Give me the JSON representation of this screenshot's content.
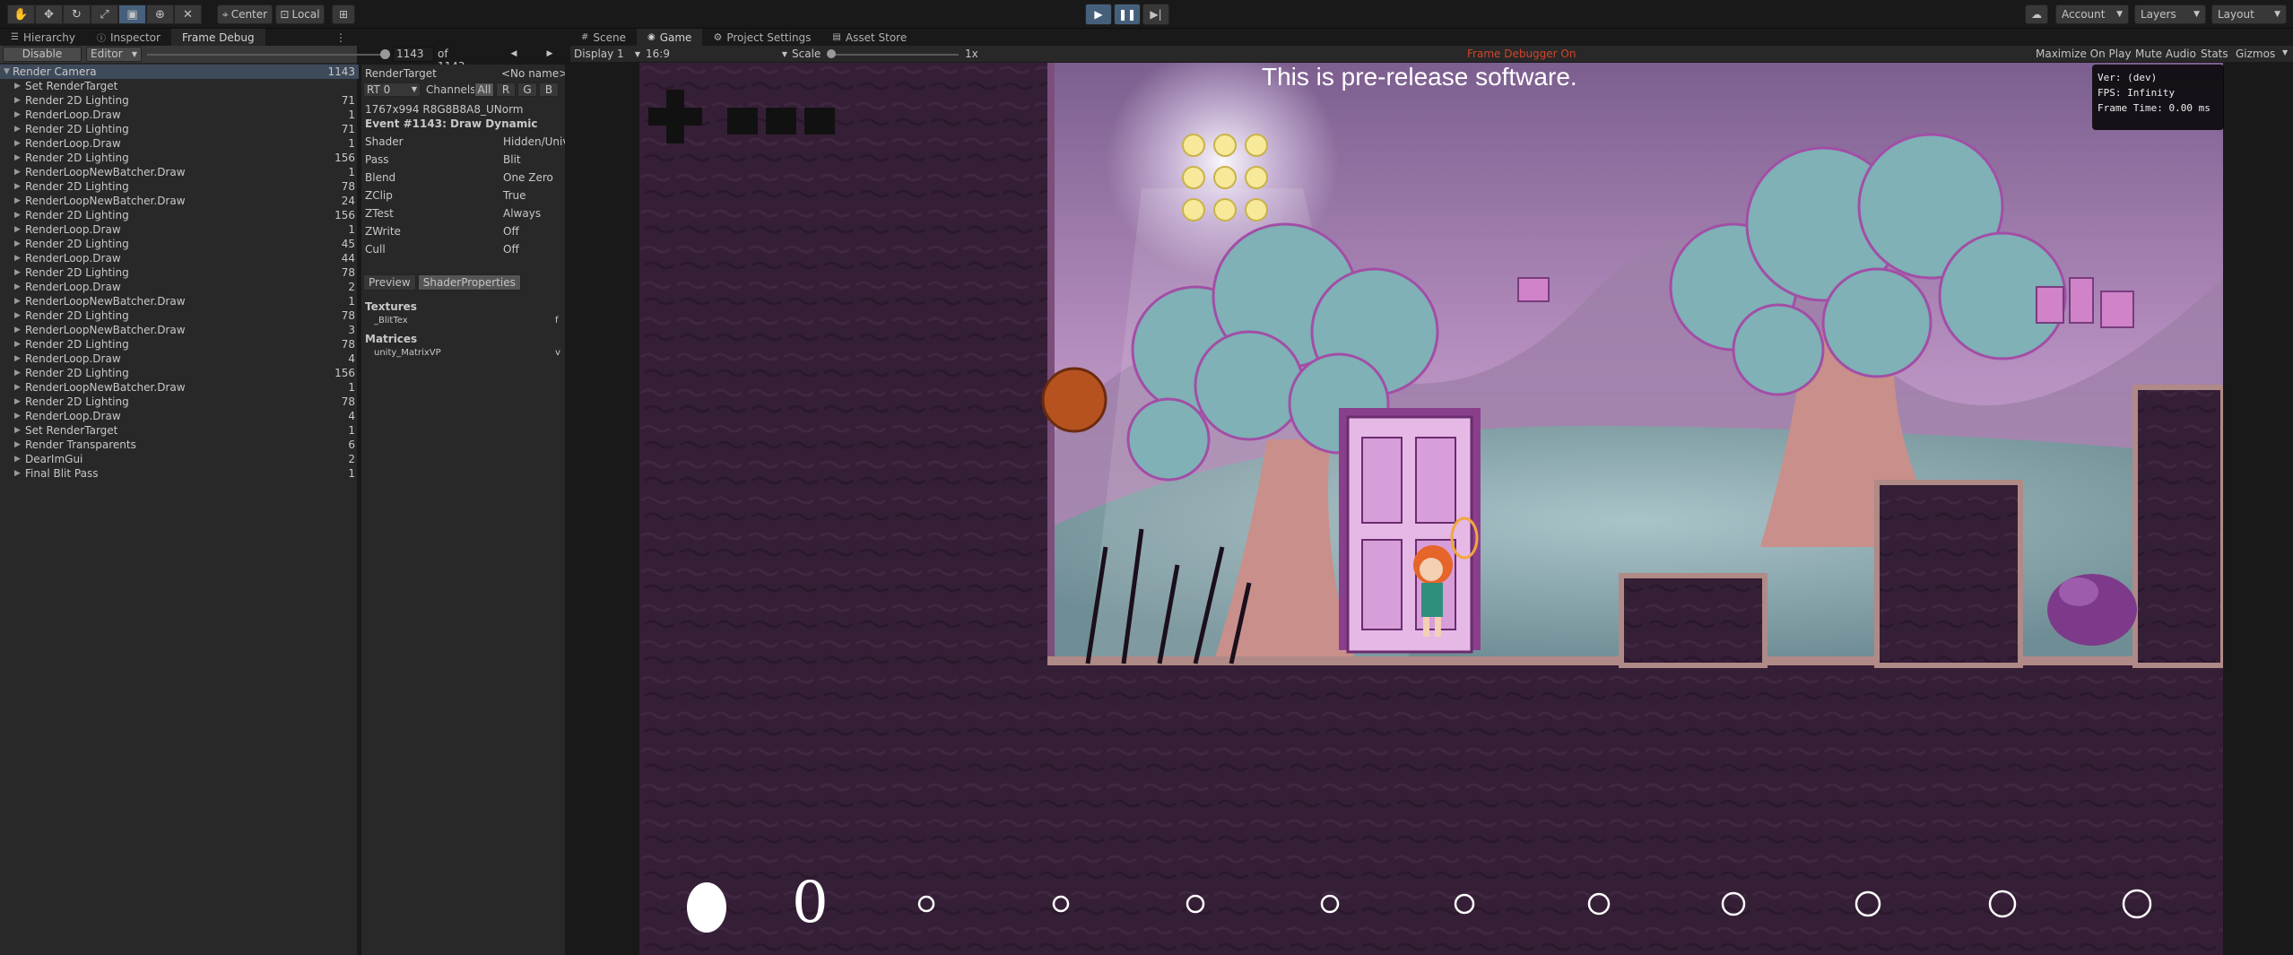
{
  "toolbar": {
    "tools": [
      "hand-tool",
      "move-tool",
      "rotate-tool",
      "scale-tool",
      "rect-tool",
      "transform-tool",
      "custom-tool"
    ],
    "center_label": "Center",
    "local_label": "Local",
    "account_label": "Account",
    "layers_label": "Layers",
    "layout_label": "Layout"
  },
  "left_tabs": {
    "hierarchy": "Hierarchy",
    "inspector": "Inspector",
    "frame_debug": "Frame Debug"
  },
  "frame_debug": {
    "disable_label": "Disable",
    "mode_label": "Editor",
    "current_event": "1143",
    "of_label": "of 1143"
  },
  "tree": [
    {
      "label": "Render Camera",
      "count": "1143",
      "level": 0,
      "expanded": true,
      "selected": true
    },
    {
      "label": "Set RenderTarget",
      "count": "",
      "level": 1
    },
    {
      "label": "Render 2D Lighting",
      "count": "71",
      "level": 1
    },
    {
      "label": "RenderLoop.Draw",
      "count": "1",
      "level": 1
    },
    {
      "label": "Render 2D Lighting",
      "count": "71",
      "level": 1
    },
    {
      "label": "RenderLoop.Draw",
      "count": "1",
      "level": 1
    },
    {
      "label": "Render 2D Lighting",
      "count": "156",
      "level": 1
    },
    {
      "label": "RenderLoopNewBatcher.Draw",
      "count": "1",
      "level": 1
    },
    {
      "label": "Render 2D Lighting",
      "count": "78",
      "level": 1
    },
    {
      "label": "RenderLoopNewBatcher.Draw",
      "count": "24",
      "level": 1
    },
    {
      "label": "Render 2D Lighting",
      "count": "156",
      "level": 1
    },
    {
      "label": "RenderLoop.Draw",
      "count": "1",
      "level": 1
    },
    {
      "label": "Render 2D Lighting",
      "count": "45",
      "level": 1
    },
    {
      "label": "RenderLoop.Draw",
      "count": "44",
      "level": 1
    },
    {
      "label": "Render 2D Lighting",
      "count": "78",
      "level": 1
    },
    {
      "label": "RenderLoop.Draw",
      "count": "2",
      "level": 1
    },
    {
      "label": "RenderLoopNewBatcher.Draw",
      "count": "1",
      "level": 1
    },
    {
      "label": "Render 2D Lighting",
      "count": "78",
      "level": 1
    },
    {
      "label": "RenderLoopNewBatcher.Draw",
      "count": "3",
      "level": 1
    },
    {
      "label": "Render 2D Lighting",
      "count": "78",
      "level": 1
    },
    {
      "label": "RenderLoop.Draw",
      "count": "4",
      "level": 1
    },
    {
      "label": "Render 2D Lighting",
      "count": "156",
      "level": 1
    },
    {
      "label": "RenderLoopNewBatcher.Draw",
      "count": "1",
      "level": 1
    },
    {
      "label": "Render 2D Lighting",
      "count": "78",
      "level": 1
    },
    {
      "label": "RenderLoop.Draw",
      "count": "4",
      "level": 1
    },
    {
      "label": "Set RenderTarget",
      "count": "1",
      "level": 1
    },
    {
      "label": "Render Transparents",
      "count": "6",
      "level": 1
    },
    {
      "label": "DearImGui",
      "count": "2",
      "level": 1
    },
    {
      "label": "Final Blit Pass",
      "count": "1",
      "level": 1
    }
  ],
  "detail": {
    "render_target_label": "RenderTarget",
    "render_target_value": "<No name>",
    "rt_select": "RT 0",
    "channels_label": "Channels",
    "channels": [
      "All",
      "R",
      "G",
      "B"
    ],
    "format": "1767x994 R8G8B8A8_UNorm",
    "event_title": "Event #1143: Draw Dynamic",
    "props": [
      {
        "k": "Shader",
        "v": "Hidden/Unive"
      },
      {
        "k": "Pass",
        "v": "Blit"
      },
      {
        "k": "Blend",
        "v": "One Zero"
      },
      {
        "k": "ZClip",
        "v": "True"
      },
      {
        "k": "ZTest",
        "v": "Always"
      },
      {
        "k": "ZWrite",
        "v": "Off"
      },
      {
        "k": "Cull",
        "v": "Off"
      }
    ],
    "preview_tab": "Preview",
    "shader_props_tab": "ShaderProperties",
    "textures_label": "Textures",
    "texture_item": "_BlitTex",
    "texture_item_value": "f",
    "matrices_label": "Matrices",
    "matrix_item": "unity_MatrixVP",
    "matrix_item_value": "v"
  },
  "right_tabs": {
    "scene": "Scene",
    "game": "Game",
    "project_settings": "Project Settings",
    "asset_store": "Asset Store"
  },
  "game_toolbar": {
    "display": "Display 1",
    "aspect": "16:9",
    "scale_label": "Scale",
    "scale_value": "1x",
    "frame_debugger_on": "Frame Debugger On",
    "maximize": "Maximize On Play",
    "mute": "Mute Audio",
    "stats": "Stats",
    "gizmos": "Gizmos"
  },
  "game": {
    "pre_release": "This is pre-release software.",
    "counter_digit": "0",
    "stats_lines": [
      "Ver: (dev)",
      "FPS: Infinity",
      "Frame Time: 0.00 ms"
    ]
  },
  "colors": {
    "accent_blue": "#46607c",
    "frame_debugger_text": "#d0452b"
  }
}
